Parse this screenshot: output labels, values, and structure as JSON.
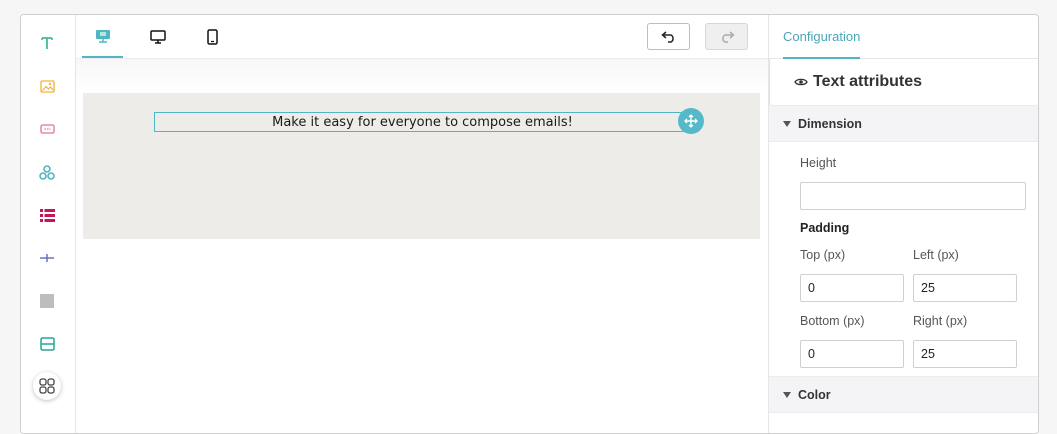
{
  "toolbar_blocks": [
    {
      "name": "text-block-icon",
      "color": "#3fbf8f"
    },
    {
      "name": "image-block-icon",
      "color": "#f2b233"
    },
    {
      "name": "button-block-icon",
      "color": "#e8718d"
    },
    {
      "name": "social-block-icon",
      "color": "#4fb6c4"
    },
    {
      "name": "list-block-icon",
      "color": "#c2185b"
    },
    {
      "name": "divider-block-icon",
      "color": "#5c6bc0"
    },
    {
      "name": "spacer-block-icon",
      "color": "#bdbdbd"
    },
    {
      "name": "section-block-icon",
      "color": "#26a69a"
    }
  ],
  "more_blocks_icon": "grid-icon",
  "devices": {
    "active": "responsive",
    "items": [
      "responsive-icon",
      "desktop-icon",
      "mobile-icon"
    ]
  },
  "history": {
    "undo_icon": "undo-icon",
    "redo_icon": "redo-icon",
    "redo_disabled": true
  },
  "canvas": {
    "text": "Make it easy for everyone to compose emails!",
    "row_background": "#edece8",
    "accent": "#4fb6c4"
  },
  "panel": {
    "tab_label": "Configuration",
    "attributes_title": "Text attributes",
    "dimension": {
      "section_label": "Dimension",
      "height_label": "Height",
      "height_value": "",
      "padding_label": "Padding",
      "top_label": "Top (px)",
      "top_value": "0",
      "left_label": "Left (px)",
      "left_value": "25",
      "bottom_label": "Bottom (px)",
      "bottom_value": "0",
      "right_label": "Right (px)",
      "right_value": "25"
    },
    "color_section_label": "Color"
  }
}
